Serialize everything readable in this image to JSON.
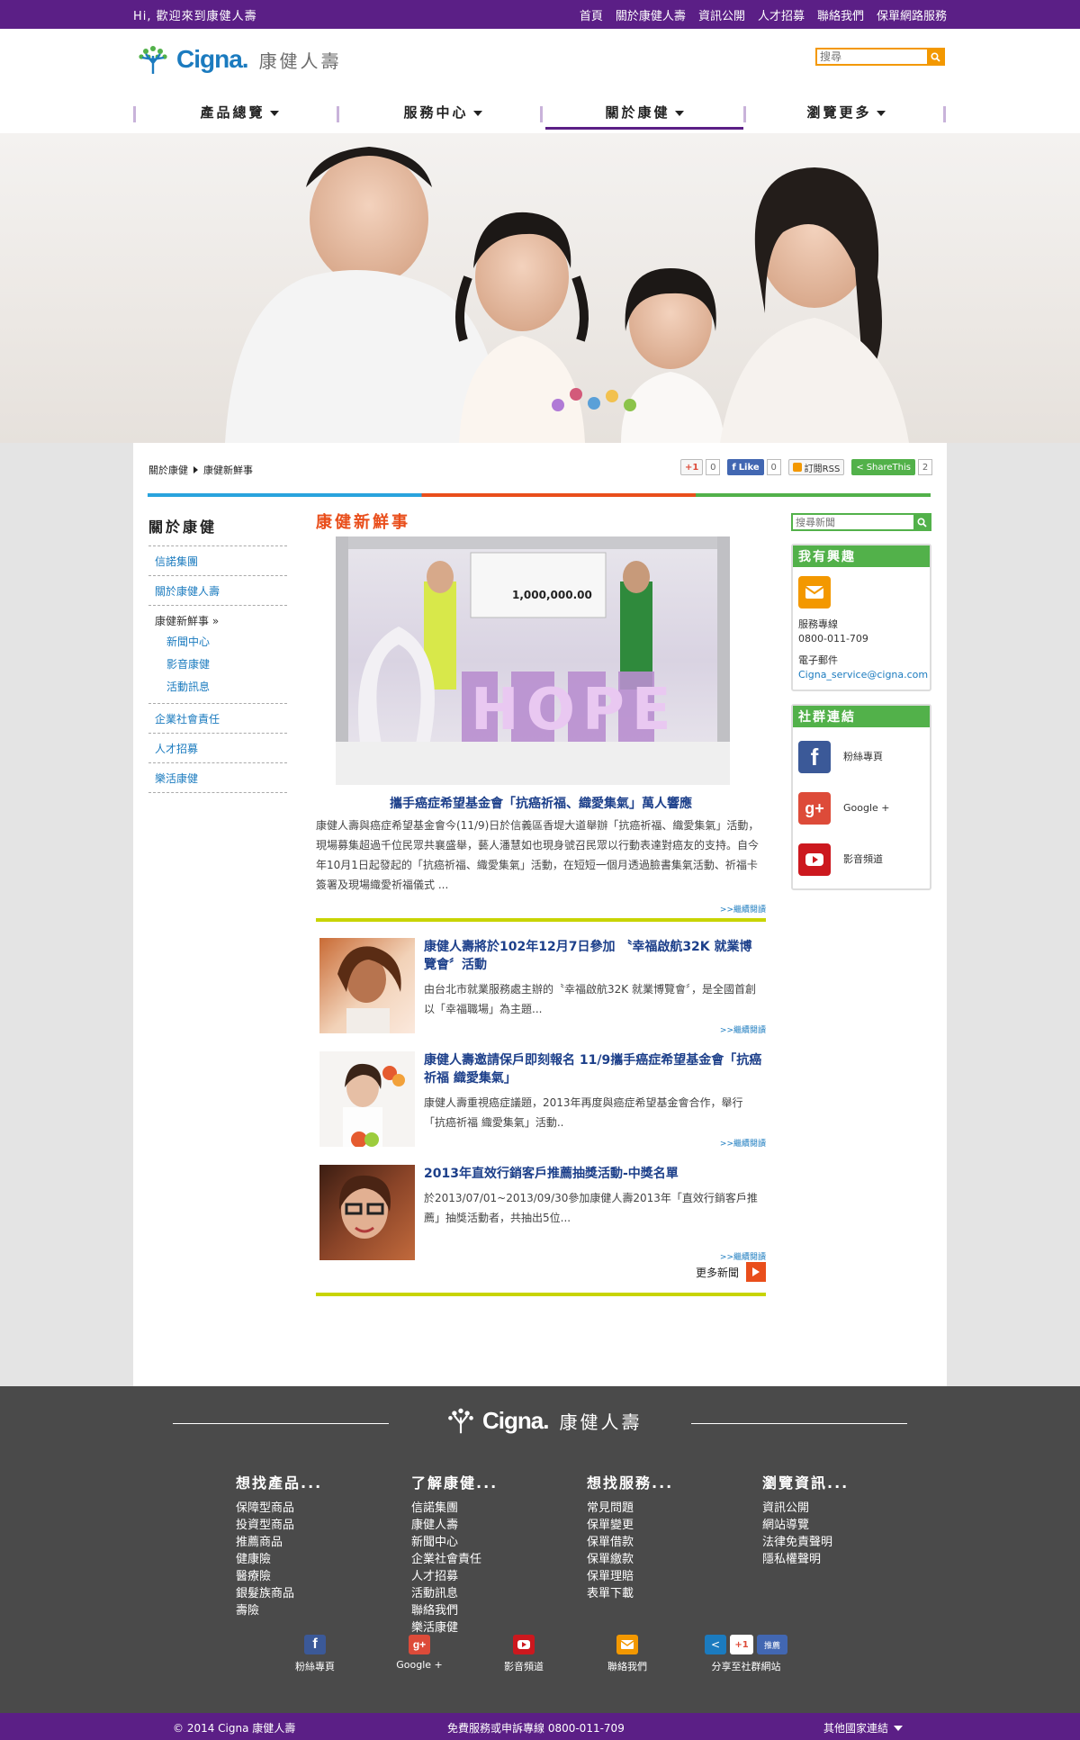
{
  "topbar": {
    "greeting": "Hi, 歡迎來到康健人壽",
    "links": [
      "首頁",
      "關於康健人壽",
      "資訊公開",
      "人才招募",
      "聯絡我們",
      "保單網路服務"
    ]
  },
  "header": {
    "logo_cigna": "Cigna.",
    "logo_name": "康健人壽",
    "search_placeholder": "搜尋",
    "nav": [
      "產品總覽",
      "服務中心",
      "關於康健",
      "瀏覽更多"
    ],
    "active_nav": "關於康健"
  },
  "breadcrumb": [
    "關於康健",
    "康健新鮮事"
  ],
  "share": {
    "gplus": "+1",
    "gplus_count": "0",
    "fb_like": "Like",
    "fb_count": "0",
    "rss": "訂閱RSS",
    "sharethis": "ShareThis",
    "share_count": "2"
  },
  "left_nav": {
    "title": "關於康健",
    "items": [
      "信諾集團",
      "關於康健人壽",
      "康健新鮮事 »",
      "企業社會責任",
      "人才招募",
      "樂活康健"
    ],
    "current": "康健新鮮事 »",
    "sub_items": [
      "新聞中心",
      "影音康健",
      "活動訊息"
    ]
  },
  "center": {
    "heading": "康健新鮮事",
    "featured": {
      "image_caption": "1,000,000.00",
      "image_word": "HOPE",
      "title": "攜手癌症希望基金會「抗癌祈福、織愛集氣」萬人響應",
      "desc": "康健人壽與癌症希望基金會今(11/9)日於信義區香堤大道舉辦「抗癌祈福、織愛集氣」活動，現場募集超過千位民眾共襄盛舉，藝人潘慧如也現身號召民眾以行動表達對癌友的支持。自今年10月1日起發起的「抗癌祈福、織愛集氣」活動，在短短一個月透過臉書集氣活動、祈福卡簽署及現場織愛祈福儀式 ...",
      "more": ">>繼續閱讀"
    },
    "news": [
      {
        "title": "康健人壽將於102年12月7日參加 〝幸福啟航32K 就業博覽會〞活動",
        "desc": "由台北市就業服務處主辦的〝幸福啟航32K 就業博覽會〞，是全國首創以「幸福職場」為主題...",
        "more": ">>繼續閱讀"
      },
      {
        "title": "康健人壽邀請保戶即刻報名 11/9攜手癌症希望基金會「抗癌祈福 織愛集氣」",
        "desc": "康健人壽重視癌症議題，2013年再度與癌症希望基金會合作，舉行「抗癌祈福 織愛集氣」活動..",
        "more": ">>繼續閱讀"
      },
      {
        "title": "2013年直效行銷客戶推薦抽獎活動-中獎名單",
        "desc": "於2013/07/01~2013/09/30參加康健人壽2013年「直效行銷客戶推薦」抽獎活動者，共抽出5位...",
        "more": ">>繼續閱讀"
      }
    ],
    "more_news": "更多新聞"
  },
  "right": {
    "search_placeholder": "搜尋新聞",
    "interest": {
      "title": "我有興趣",
      "phone_label": "服務專線",
      "phone": "0800-011-709",
      "email_label": "電子郵件",
      "email": "Cigna_service@cigna.com"
    },
    "social": {
      "title": "社群連結",
      "items": [
        "粉絲專頁",
        "Google +",
        "影音頻道"
      ]
    }
  },
  "footer": {
    "logo_cigna": "Cigna.",
    "logo_name": "康健人壽",
    "cols": [
      {
        "title": "想找產品...",
        "items": [
          "保障型商品",
          "投資型商品",
          "推薦商品",
          "健康險",
          "醫療險",
          "銀髮族商品",
          "壽險"
        ]
      },
      {
        "title": "了解康健...",
        "items": [
          "信諾集團",
          "康健人壽",
          "新聞中心",
          "企業社會責任",
          "人才招募",
          "活動訊息",
          "聯絡我們",
          "樂活康健"
        ]
      },
      {
        "title": "想找服務...",
        "items": [
          "常見問題",
          "保單變更",
          "保單借款",
          "保單繳款",
          "保單理賠",
          "表單下載"
        ]
      },
      {
        "title": "瀏覽資訊...",
        "items": [
          "資訊公開",
          "網站導覽",
          "法律免責聲明",
          "隱私權聲明"
        ]
      }
    ],
    "social": [
      "粉絲專頁",
      "Google +",
      "影音頻道",
      "聯絡我們",
      "分享至社群網站"
    ],
    "share_mini": [
      "+1",
      "推薦"
    ]
  },
  "bottom": {
    "copyright": "© 2014 Cigna 康健人壽",
    "hotline": "免費服務或申訴專線 0800-011-709",
    "other": "其他國家連結"
  },
  "colors": {
    "purple": "#5b1f86",
    "orange": "#f39800",
    "green": "#52b14a",
    "red_orange": "#e94e1b",
    "blue": "#1b7bbf",
    "navy": "#1c3f8a",
    "lime": "#c8d400"
  }
}
